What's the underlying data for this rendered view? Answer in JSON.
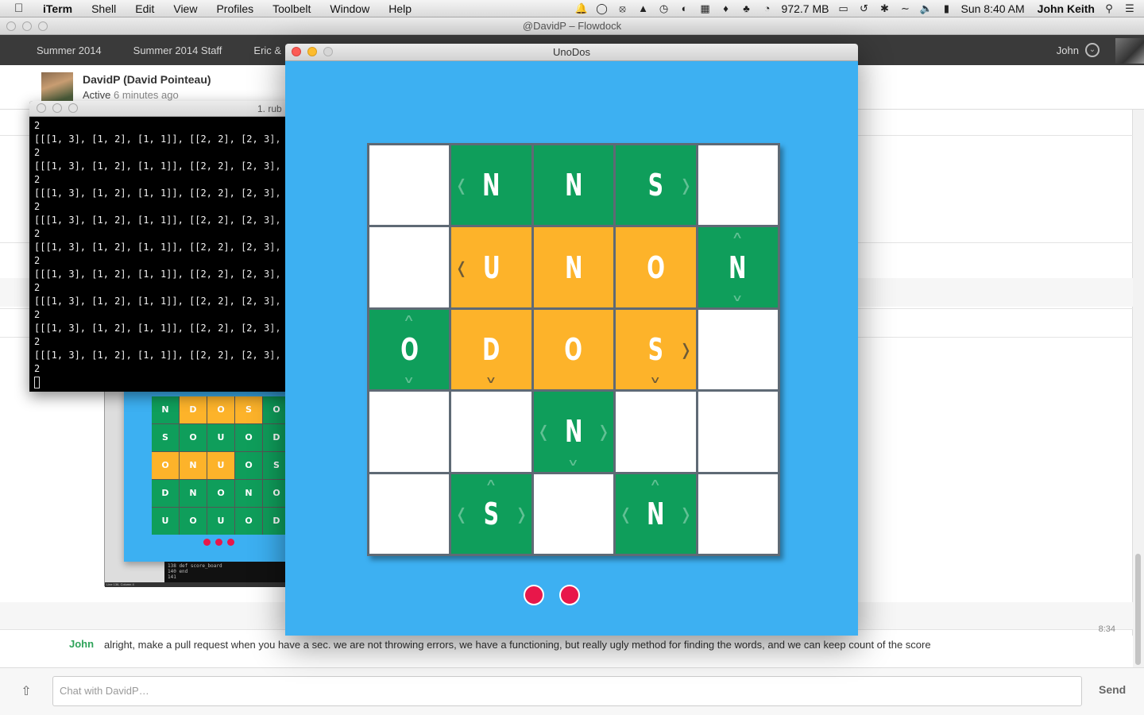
{
  "menubar": {
    "app": "iTerm",
    "items": [
      "Shell",
      "Edit",
      "View",
      "Profiles",
      "Toolbelt",
      "Window",
      "Help"
    ],
    "memory": "972.7 MB",
    "clock": "Sun 8:40 AM",
    "user": "John Keith"
  },
  "flowdock": {
    "window_title": "@DavidP – Flowdock",
    "tabs": [
      "Summer 2014",
      "Summer 2014 Staff",
      "Eric &"
    ],
    "nav_user": "John",
    "contact_name": "DavidP (David Pointeau)",
    "contact_status": "Active",
    "contact_ago": "6 minutes ago",
    "message": {
      "time": "8:34",
      "author": "John",
      "text": "alright, make a pull request when you have a sec. we are not throwing errors, we have a functioning, but really ugly method for finding the words, and we can keep count of the score"
    },
    "composer_placeholder": "Chat with DavidP…",
    "send_label": "Send"
  },
  "iterm": {
    "title": "1. rub",
    "lines": [
      "2",
      "[[[1, 3], [1, 2], [1, 1]], [[2, 2], [2, 3], [",
      "2",
      "[[[1, 3], [1, 2], [1, 1]], [[2, 2], [2, 3], [",
      "2",
      "[[[1, 3], [1, 2], [1, 1]], [[2, 2], [2, 3], [",
      "2",
      "[[[1, 3], [1, 2], [1, 1]], [[2, 2], [2, 3], [",
      "2",
      "[[[1, 3], [1, 2], [1, 1]], [[2, 2], [2, 3], [",
      "2",
      "[[[1, 3], [1, 2], [1, 1]], [[2, 2], [2, 3], [",
      "2",
      "[[[1, 3], [1, 2], [1, 1]], [[2, 2], [2, 3], [",
      "2",
      "[[[1, 3], [1, 2], [1, 1]], [[2, 2], [2, 3], [",
      "2",
      "[[[1, 3], [1, 2], [1, 1]], [[2, 2], [2, 3], [",
      "2"
    ]
  },
  "thumbnail": {
    "grid": [
      [
        "N",
        "D",
        "O",
        "S",
        "O"
      ],
      [
        "S",
        "O",
        "U",
        "O",
        "D"
      ],
      [
        "O",
        "N",
        "U",
        "O",
        "S"
      ],
      [
        "D",
        "N",
        "O",
        "N",
        "O"
      ],
      [
        "U",
        "O",
        "U",
        "O",
        "D"
      ]
    ],
    "colors": [
      [
        "g",
        "o",
        "o",
        "o",
        "g"
      ],
      [
        "g",
        "g",
        "g",
        "g",
        "g"
      ],
      [
        "o",
        "o",
        "o",
        "g",
        "g"
      ],
      [
        "g",
        "g",
        "g",
        "g",
        "g"
      ],
      [
        "g",
        "g",
        "g",
        "g",
        "g"
      ]
    ],
    "term_lines": [
      "138   def score_board",
      "140   end",
      "141"
    ],
    "status": "Line 136, Column 4"
  },
  "unodos": {
    "window_title": "UnoDos",
    "colors": {
      "green": "#0f9e5b",
      "orange": "#fdb32a",
      "empty": "#ffffff",
      "background": "#3db0f2",
      "dot": "#e8174a"
    },
    "board": [
      [
        {
          "c": "empty"
        },
        {
          "c": "green",
          "l": "N",
          "a": [
            "left"
          ]
        },
        {
          "c": "green",
          "l": "N"
        },
        {
          "c": "green",
          "l": "S",
          "a": [
            "right"
          ]
        },
        {
          "c": "empty"
        }
      ],
      [
        {
          "c": "empty"
        },
        {
          "c": "orange",
          "l": "U",
          "a": [
            "left"
          ]
        },
        {
          "c": "orange",
          "l": "N"
        },
        {
          "c": "orange",
          "l": "O"
        },
        {
          "c": "green",
          "l": "N",
          "a": [
            "up",
            "down"
          ]
        }
      ],
      [
        {
          "c": "green",
          "l": "O",
          "a": [
            "up",
            "down"
          ]
        },
        {
          "c": "orange",
          "l": "D",
          "a": [
            "down"
          ]
        },
        {
          "c": "orange",
          "l": "O"
        },
        {
          "c": "orange",
          "l": "S",
          "a": [
            "right",
            "down"
          ]
        },
        {
          "c": "empty"
        }
      ],
      [
        {
          "c": "empty"
        },
        {
          "c": "empty"
        },
        {
          "c": "green",
          "l": "N",
          "a": [
            "left",
            "right",
            "down"
          ]
        },
        {
          "c": "empty"
        },
        {
          "c": "empty"
        }
      ],
      [
        {
          "c": "empty"
        },
        {
          "c": "green",
          "l": "S",
          "a": [
            "up",
            "left",
            "right"
          ]
        },
        {
          "c": "empty"
        },
        {
          "c": "green",
          "l": "N",
          "a": [
            "up",
            "left",
            "right"
          ]
        },
        {
          "c": "empty"
        }
      ]
    ],
    "remaining_dots": 2
  }
}
